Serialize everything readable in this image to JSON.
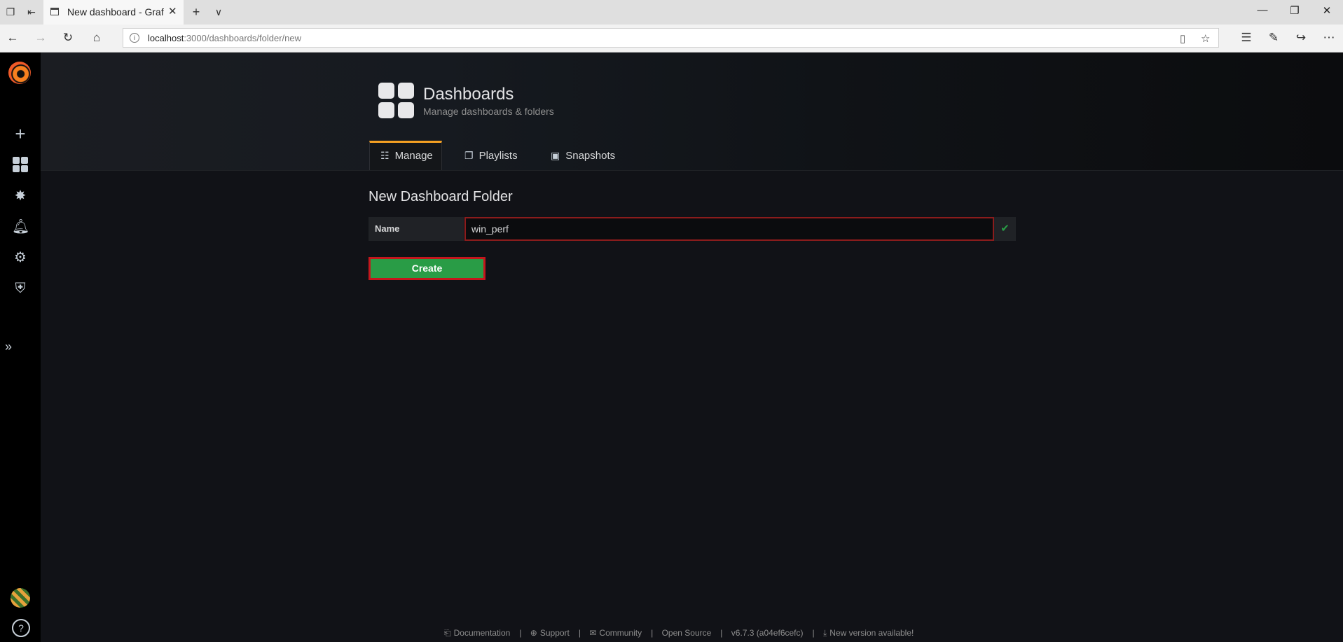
{
  "browser": {
    "tab_title": "New dashboard - Grafana",
    "url_host": "localhost",
    "url_path": ":3000/dashboards/folder/new"
  },
  "page_header": {
    "title": "Dashboards",
    "subtitle": "Manage dashboards & folders",
    "tabs": [
      {
        "label": "Manage",
        "icon": "sitemap-icon",
        "active": true
      },
      {
        "label": "Playlists",
        "icon": "playlist-icon",
        "active": false
      },
      {
        "label": "Snapshots",
        "icon": "snapshot-icon",
        "active": false
      }
    ]
  },
  "form": {
    "page_title": "New Dashboard Folder",
    "name_label": "Name",
    "name_value": "win_perf",
    "create_label": "Create"
  },
  "footer": {
    "documentation": "Documentation",
    "support": "Support",
    "community": "Community",
    "open_source": "Open Source",
    "version": "v6.7.3 (a04ef6cefc)",
    "new_version": "New version available!"
  },
  "colors": {
    "accent_orange": "#f5a022",
    "create_green": "#299c46",
    "highlight_red": "#c4161c"
  }
}
